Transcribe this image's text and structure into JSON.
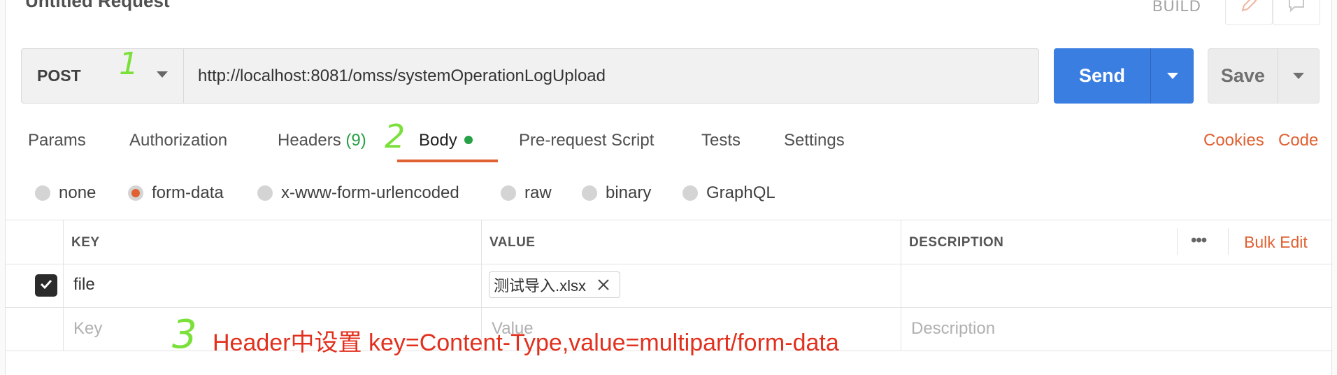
{
  "request": {
    "title": "Untitled Request",
    "build_label": "BUILD",
    "method": "POST",
    "url": "http://localhost:8081/omss/systemOperationLogUpload",
    "send_label": "Send",
    "save_label": "Save"
  },
  "tabs": {
    "params": "Params",
    "authorization": "Authorization",
    "headers": "Headers",
    "headers_count": "(9)",
    "body": "Body",
    "prerequest": "Pre-request Script",
    "tests": "Tests",
    "settings": "Settings",
    "active": "Body"
  },
  "links": {
    "cookies": "Cookies",
    "code": "Code"
  },
  "body_types": {
    "none": "none",
    "form_data": "form-data",
    "urlencoded": "x-www-form-urlencoded",
    "raw": "raw",
    "binary": "binary",
    "graphql": "GraphQL",
    "selected": "form-data"
  },
  "table": {
    "col_key": "KEY",
    "col_value": "VALUE",
    "col_description": "DESCRIPTION",
    "more": "•••",
    "bulk_edit": "Bulk Edit",
    "row": {
      "checked": true,
      "key": "file",
      "value_file": "测试导入.xlsx"
    },
    "empty_row": {
      "key_placeholder": "Key",
      "value_placeholder": "Value",
      "description_placeholder": "Description"
    }
  },
  "annotations": {
    "mark1": "1",
    "mark2": "2",
    "mark3": "3",
    "note": "Header中设置 key=Content-Type,value=multipart/form-data"
  },
  "colors": {
    "accent": "#e06132",
    "send_blue": "#3a7ee2",
    "status_green": "#27a146",
    "annotation_green": "#7ae03a",
    "annotation_red": "#e2301e"
  }
}
